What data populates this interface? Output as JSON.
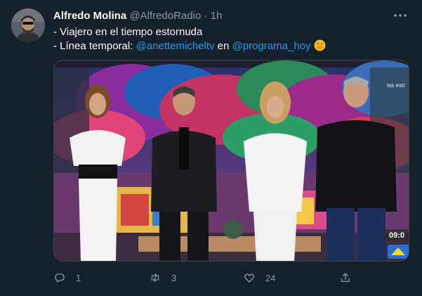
{
  "tweet": {
    "author_name": "Alfredo Molina",
    "author_handle": "@AlfredoRadio",
    "separator": "·",
    "timestamp": "1h",
    "text_line1": "- Viajero en el tiempo estornuda",
    "text_line2_prefix": "- Línea temporal: ",
    "mention1": "@anettemicheltv",
    "text_connector": " en ",
    "mention2": "@programa_hoy",
    "emoji": "face-with-hand-over-mouth"
  },
  "media": {
    "watermark_top_right": "las estr",
    "clock_label": "09:0"
  },
  "actions": {
    "reply_count": "1",
    "retweet_count": "3",
    "like_count": "24"
  },
  "colors": {
    "background": "#15202b",
    "link": "#1d9bf0",
    "muted": "#8b98a5"
  }
}
